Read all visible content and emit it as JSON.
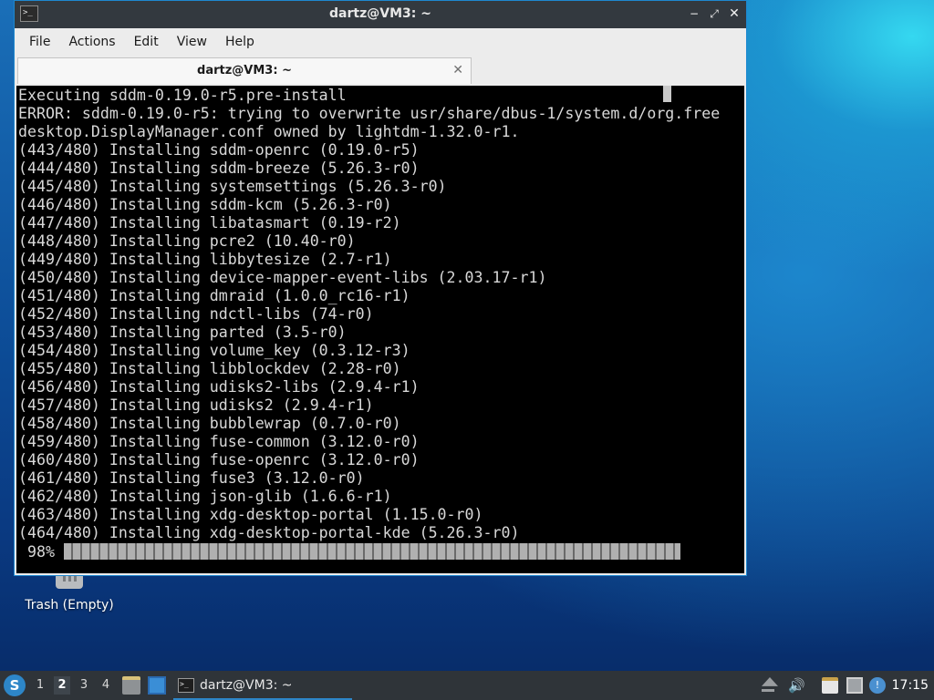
{
  "desktop": {
    "trash_label": "Trash (Empty)"
  },
  "window": {
    "title": "dartz@VM3: ~",
    "controls": {
      "minimize": "−",
      "maximize": "⤢",
      "close": "✕"
    },
    "menu": [
      "File",
      "Actions",
      "Edit",
      "View",
      "Help"
    ],
    "tab": {
      "title": "dartz@VM3: ~",
      "close": "✕"
    }
  },
  "terminal": {
    "lines": [
      "Executing sddm-0.19.0-r5.pre-install",
      "ERROR: sddm-0.19.0-r5: trying to overwrite usr/share/dbus-1/system.d/org.free",
      "desktop.DisplayManager.conf owned by lightdm-1.32.0-r1.",
      "(443/480) Installing sddm-openrc (0.19.0-r5)",
      "(444/480) Installing sddm-breeze (5.26.3-r0)",
      "(445/480) Installing systemsettings (5.26.3-r0)",
      "(446/480) Installing sddm-kcm (5.26.3-r0)",
      "(447/480) Installing libatasmart (0.19-r2)",
      "(448/480) Installing pcre2 (10.40-r0)",
      "(449/480) Installing libbytesize (2.7-r1)",
      "(450/480) Installing device-mapper-event-libs (2.03.17-r1)",
      "(451/480) Installing dmraid (1.0.0_rc16-r1)",
      "(452/480) Installing ndctl-libs (74-r0)",
      "(453/480) Installing parted (3.5-r0)",
      "(454/480) Installing volume_key (0.3.12-r3)",
      "(455/480) Installing libblockdev (2.28-r0)",
      "(456/480) Installing udisks2-libs (2.9.4-r1)",
      "(457/480) Installing udisks2 (2.9.4-r1)",
      "(458/480) Installing bubblewrap (0.7.0-r0)",
      "(459/480) Installing fuse-common (3.12.0-r0)",
      "(460/480) Installing fuse-openrc (3.12.0-r0)",
      "(461/480) Installing fuse3 (3.12.0-r0)",
      "(462/480) Installing json-glib (1.6.6-r1)",
      "(463/480) Installing xdg-desktop-portal (1.15.0-r0)",
      "(464/480) Installing xdg-desktop-portal-kde (5.26.3-r0)"
    ],
    "progress_label": " 98%",
    "progress_fraction": 0.98
  },
  "taskbar": {
    "start_icon": "start-menu-icon",
    "workspaces": [
      "1",
      "2",
      "3",
      "4"
    ],
    "active_workspace": "2",
    "task_label": "dartz@VM3: ~",
    "clock": "17:15"
  }
}
